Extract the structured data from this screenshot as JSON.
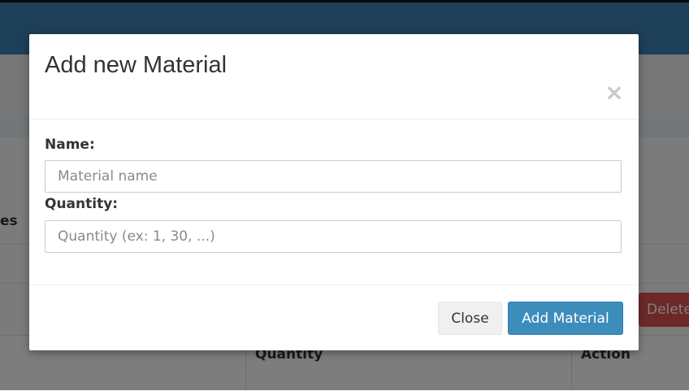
{
  "background": {
    "partial_heading": "es",
    "delete_button": "Delete",
    "table_headers": [
      "Quantity",
      "Action"
    ]
  },
  "modal": {
    "title": "Add new Material",
    "close_icon": "×",
    "fields": {
      "name": {
        "label": "Name:",
        "placeholder": "Material name",
        "value": ""
      },
      "quantity": {
        "label": "Quantity:",
        "placeholder": "Quantity (ex: 1, 30, ...)",
        "value": ""
      }
    },
    "buttons": {
      "close": "Close",
      "add": "Add Material"
    }
  },
  "colors": {
    "primary_button": "#3c8dbc",
    "danger_button": "#d9534f",
    "navbar": "#3a7fb0"
  }
}
